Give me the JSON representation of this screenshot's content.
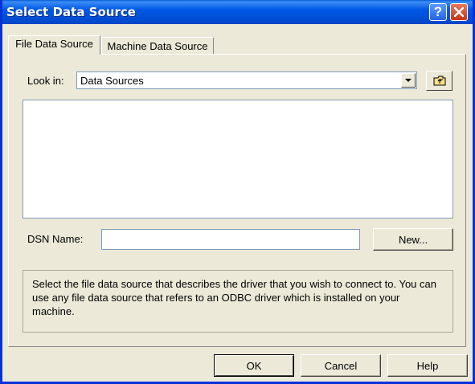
{
  "window": {
    "title": "Select Data Source",
    "title_color": "#0054e3"
  },
  "tabs": [
    {
      "label": "File Data Source",
      "active": true
    },
    {
      "label": "Machine Data Source",
      "active": false
    }
  ],
  "look_in": {
    "label": "Look in:",
    "value": "Data Sources",
    "up_folder_icon": "up-one-level-folder-icon"
  },
  "dsn": {
    "label": "DSN Name:",
    "value": "",
    "new_button": "New..."
  },
  "description": "Select the file data source that describes the driver that you wish to connect to.  You can use any file data source that refers to an ODBC driver which is installed on your machine.",
  "buttons": {
    "ok": "OK",
    "cancel": "Cancel",
    "help": "Help"
  },
  "titlebar_buttons": {
    "help": "?",
    "close": "close-icon"
  }
}
